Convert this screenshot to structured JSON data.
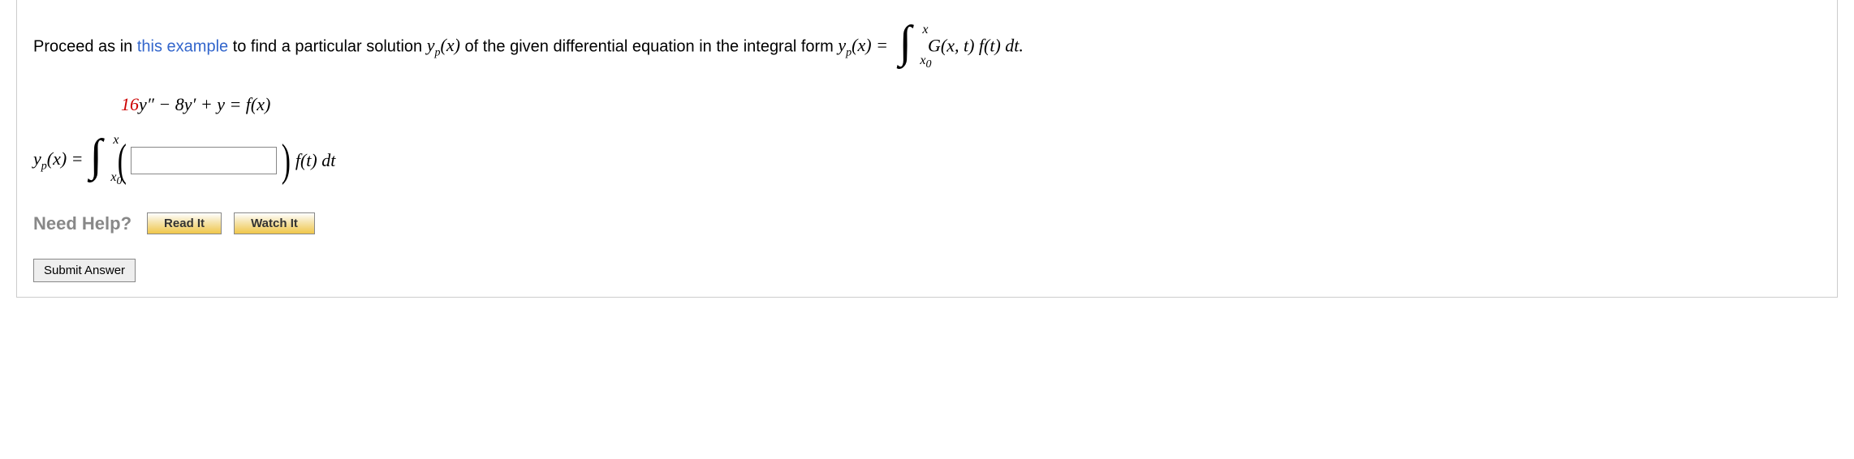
{
  "prompt": {
    "pre": "Proceed as in ",
    "link": "this example",
    "mid": " to find a particular solution ",
    "yp1": "y",
    "yp1_sub": "p",
    "yp1_arg": "(x)",
    "mid2": " of the given differential equation in the integral form ",
    "yp2": "y",
    "yp2_sub": "p",
    "yp2_arg": "(x) = ",
    "int_upper": "x",
    "int_lower": "x",
    "int_lower_sub": "0",
    "integrand": "G(x, t) f(t) dt."
  },
  "equation": {
    "coef1": "16",
    "body": "y″ − 8y′ + y = f(x)"
  },
  "answer": {
    "lhs_y": "y",
    "lhs_sub": "p",
    "lhs_arg": "(x) = ",
    "int_upper": "x",
    "int_lower": "x",
    "int_lower_sub": "0",
    "after": "f(t) dt",
    "input_value": ""
  },
  "help": {
    "label": "Need Help?",
    "read": "Read It",
    "watch": "Watch It"
  },
  "submit": "Submit Answer"
}
